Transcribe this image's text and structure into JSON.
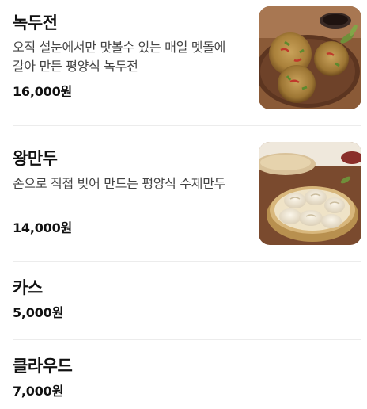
{
  "menu": {
    "items": [
      {
        "name": "녹두전",
        "description": "오직 설눈에서만 맛볼수 있는 매일 멧돌에 갈아 만든 평양식 녹두전",
        "price": "16,000원",
        "image": "mung-bean-pancake-photo"
      },
      {
        "name": "왕만두",
        "description": "손으로 직접 빚어 만드는 평양식 수제만두",
        "price": "14,000원",
        "image": "dumplings-in-steamer-photo"
      },
      {
        "name": "카스",
        "price": "5,000원"
      },
      {
        "name": "클라우드",
        "price": "7,000원"
      }
    ]
  }
}
